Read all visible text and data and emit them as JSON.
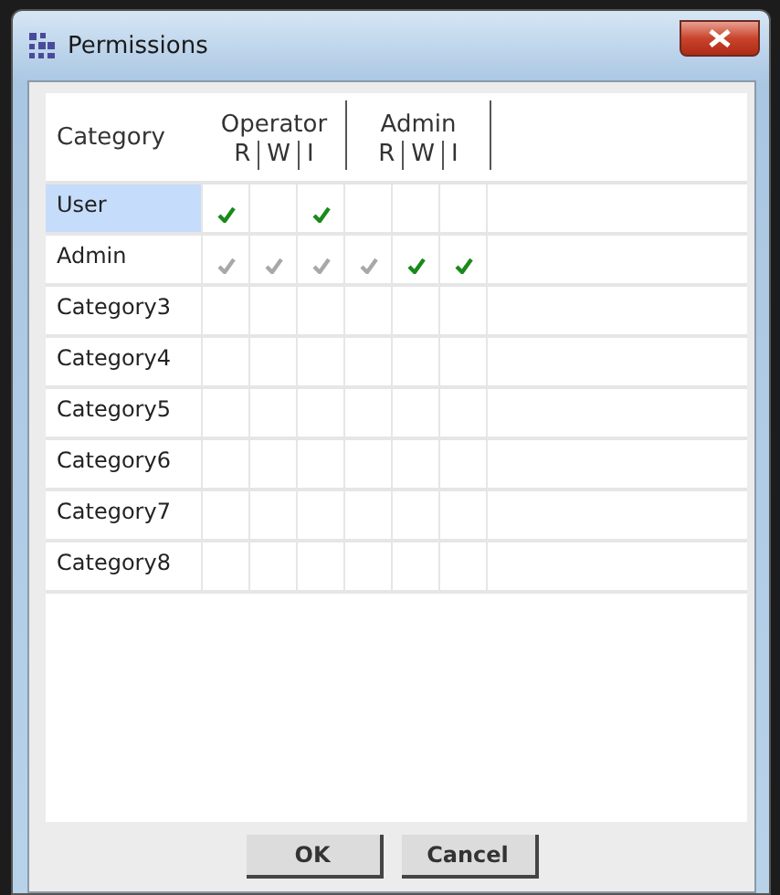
{
  "window": {
    "title": "Permissions"
  },
  "table": {
    "category_header": "Category",
    "groups": [
      {
        "label": "Operator",
        "columns": [
          "R",
          "W",
          "I"
        ]
      },
      {
        "label": "Admin",
        "columns": [
          "R",
          "W",
          "I"
        ]
      }
    ],
    "rows": [
      {
        "category": "User",
        "selected": true,
        "cells": [
          {
            "checked": true,
            "disabled": false
          },
          {
            "checked": false
          },
          {
            "checked": true,
            "disabled": false
          },
          {
            "checked": false
          },
          {
            "checked": false
          },
          {
            "checked": false
          }
        ]
      },
      {
        "category": "Admin",
        "selected": false,
        "cells": [
          {
            "checked": true,
            "disabled": true
          },
          {
            "checked": true,
            "disabled": true
          },
          {
            "checked": true,
            "disabled": true
          },
          {
            "checked": true,
            "disabled": true
          },
          {
            "checked": true,
            "disabled": false
          },
          {
            "checked": true,
            "disabled": false
          }
        ]
      },
      {
        "category": "Category3",
        "selected": false,
        "cells": [
          {
            "checked": false
          },
          {
            "checked": false
          },
          {
            "checked": false
          },
          {
            "checked": false
          },
          {
            "checked": false
          },
          {
            "checked": false
          }
        ]
      },
      {
        "category": "Category4",
        "selected": false,
        "cells": [
          {
            "checked": false
          },
          {
            "checked": false
          },
          {
            "checked": false
          },
          {
            "checked": false
          },
          {
            "checked": false
          },
          {
            "checked": false
          }
        ]
      },
      {
        "category": "Category5",
        "selected": false,
        "cells": [
          {
            "checked": false
          },
          {
            "checked": false
          },
          {
            "checked": false
          },
          {
            "checked": false
          },
          {
            "checked": false
          },
          {
            "checked": false
          }
        ]
      },
      {
        "category": "Category6",
        "selected": false,
        "cells": [
          {
            "checked": false
          },
          {
            "checked": false
          },
          {
            "checked": false
          },
          {
            "checked": false
          },
          {
            "checked": false
          },
          {
            "checked": false
          }
        ]
      },
      {
        "category": "Category7",
        "selected": false,
        "cells": [
          {
            "checked": false
          },
          {
            "checked": false
          },
          {
            "checked": false
          },
          {
            "checked": false
          },
          {
            "checked": false
          },
          {
            "checked": false
          }
        ]
      },
      {
        "category": "Category8",
        "selected": false,
        "cells": [
          {
            "checked": false
          },
          {
            "checked": false
          },
          {
            "checked": false
          },
          {
            "checked": false
          },
          {
            "checked": false
          },
          {
            "checked": false
          }
        ]
      }
    ]
  },
  "buttons": [
    "OK",
    "Cancel"
  ]
}
